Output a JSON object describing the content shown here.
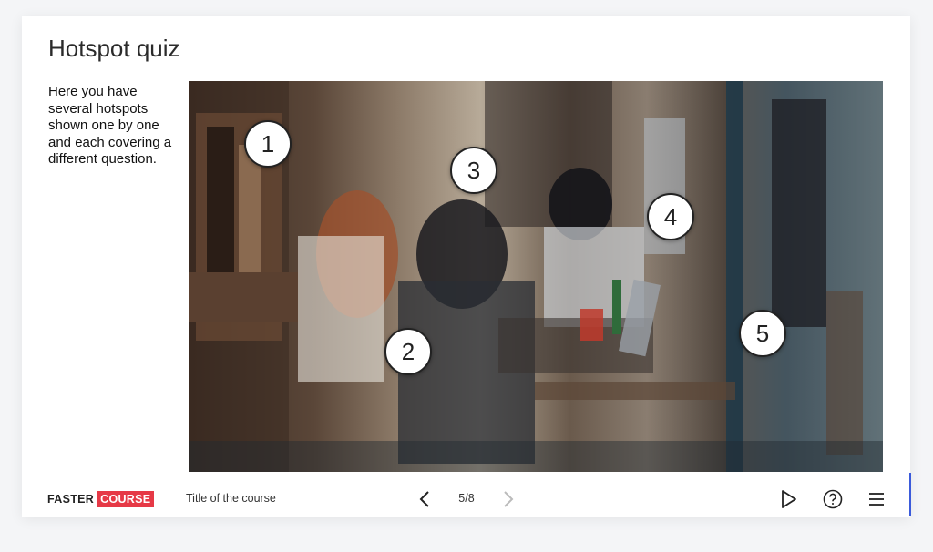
{
  "quiz": {
    "title": "Hotspot quiz",
    "description": "Here you have several hotspots shown one by one and each covering a different question."
  },
  "hotspots": [
    {
      "label": "1"
    },
    {
      "label": "2"
    },
    {
      "label": "3"
    },
    {
      "label": "4"
    },
    {
      "label": "5"
    }
  ],
  "footer": {
    "logo_part1": "FASTER",
    "logo_part2": "COURSE",
    "course_title": "Title of the course",
    "page_indicator": "5/8",
    "icons": {
      "prev": "chevron-left-icon",
      "next": "chevron-right-icon",
      "play": "play-icon",
      "help": "help-circle-icon",
      "menu": "menu-icon"
    }
  },
  "colors": {
    "brand_red": "#e63946",
    "text": "#222222",
    "disabled": "#bbbbbb",
    "accent_line": "#3b5bdb"
  }
}
